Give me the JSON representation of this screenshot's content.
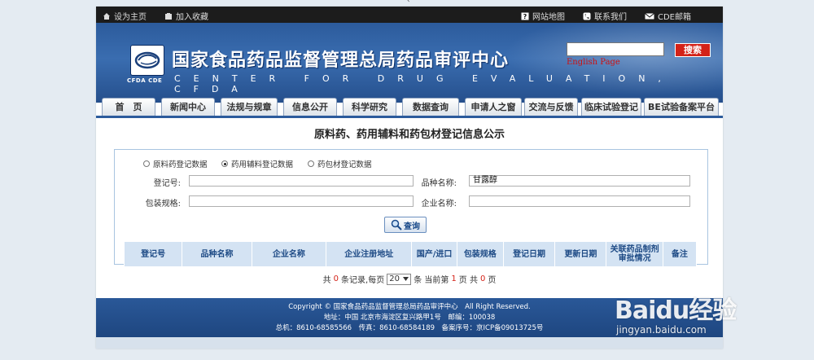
{
  "topbar": {
    "set_home": "设为主页",
    "add_fav": "加入收藏",
    "sitemap": "网站地图",
    "contact": "联系我们",
    "mail": "CDE邮箱"
  },
  "header": {
    "logo_text": "CFDA CDE",
    "title_cn": "国家食品药品监督管理总局药品审评中心",
    "title_en": "CENTER FOR DRUG EVALUATION, CFDA",
    "search_label": "搜索",
    "english_link": "English Page"
  },
  "nav": [
    "首　页",
    "新闻中心",
    "法规与规章",
    "信息公开",
    "科学研究",
    "数据查询",
    "申请人之窗",
    "交流与反馈",
    "临床试验登记",
    "BE试验备案平台"
  ],
  "main": {
    "title": "原料药、药用辅料和药包材登记信息公示",
    "radios": [
      {
        "label": "原料药登记数据",
        "selected": false
      },
      {
        "label": "药用辅料登记数据",
        "selected": true
      },
      {
        "label": "药包材登记数据",
        "selected": false
      }
    ],
    "fields": {
      "reg_no_label": "登记号:",
      "reg_no_value": "",
      "variety_label": "品种名称:",
      "variety_value": "甘露醇",
      "pack_label": "包装规格:",
      "pack_value": "",
      "company_label": "企业名称:",
      "company_value": ""
    },
    "query_label": "查询",
    "table_headers": [
      "登记号",
      "品种名称",
      "企业名称",
      "企业注册地址",
      "国产/进口",
      "包装规格",
      "登记日期",
      "更新日期",
      "关联药品制剂审批情况",
      "备注"
    ],
    "pager": {
      "prefix": "共",
      "records": "0",
      "records_suffix": "条记录,每页",
      "per_page": "20",
      "mid": "条 当前第",
      "current": "1",
      "page_suffix": "页 共",
      "total": "0",
      "end": "页"
    }
  },
  "footer": {
    "line1": "Copyright © 国家食品药品监督管理总局药品审评中心　All Right Reserved.",
    "line2": "地址：中国 北京市海淀区复兴路甲1号　邮编：100038",
    "line3": "总机：8610-68585566　传真：8610-68584189　备案序号：京ICP备09013725号"
  },
  "watermark": {
    "brand": "Baidu经验",
    "url": "jingyan.baidu.com"
  },
  "colors": {
    "header_blue": "#2c5b9c",
    "accent_red": "#d42218",
    "table_header": "#d4e3f3"
  }
}
